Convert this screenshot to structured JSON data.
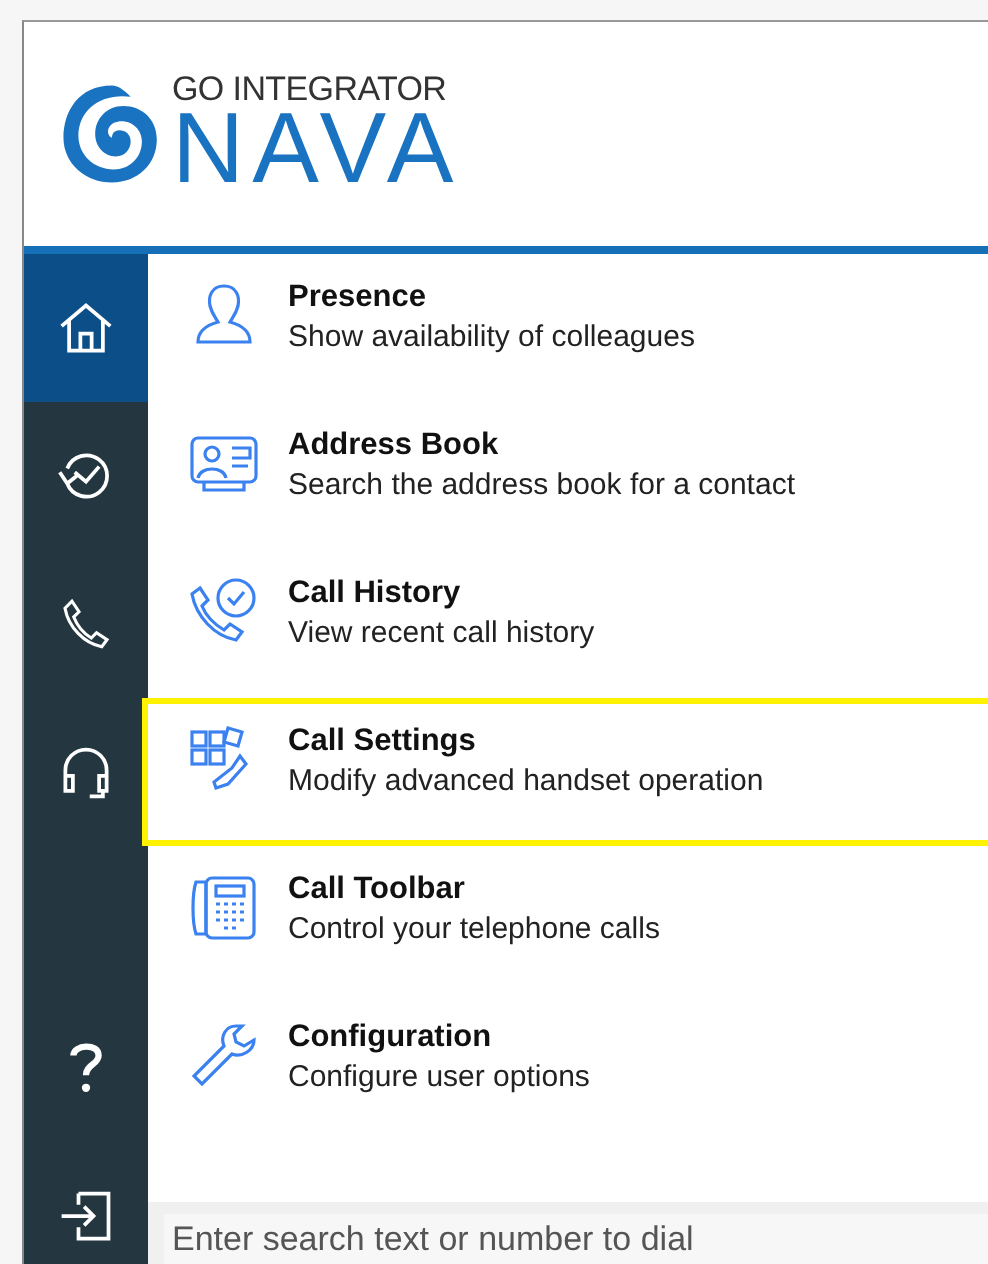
{
  "logo": {
    "brand": "GO INTEGRATOR",
    "product": "NAVA"
  },
  "sidebar": {
    "items": [
      {
        "selected": true
      },
      {
        "selected": false
      },
      {
        "selected": false
      },
      {
        "selected": false
      }
    ]
  },
  "menu": [
    {
      "title": "Presence",
      "description": "Show availability of colleagues",
      "highlighted": false
    },
    {
      "title": "Address Book",
      "description": "Search the address book for a contact",
      "highlighted": false
    },
    {
      "title": "Call History",
      "description": "View recent call history",
      "highlighted": false
    },
    {
      "title": "Call Settings",
      "description": "Modify advanced handset operation",
      "highlighted": true
    },
    {
      "title": "Call Toolbar",
      "description": "Control your telephone calls",
      "highlighted": false
    },
    {
      "title": "Configuration",
      "description": "Configure user options",
      "highlighted": false
    }
  ],
  "search": {
    "placeholder": "Enter search text or number to dial"
  }
}
